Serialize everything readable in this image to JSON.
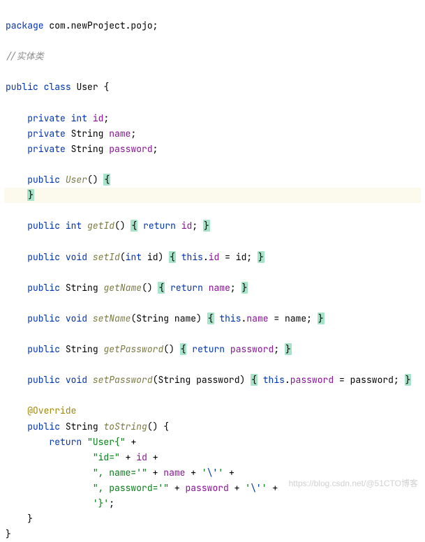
{
  "code": {
    "package_kw": "package",
    "package_name": "com.newProject.pojo",
    "comment": "//实体类",
    "class_decl": {
      "public": "public",
      "class": "class",
      "name": "User"
    },
    "fields": {
      "private": "private",
      "int": "int",
      "string": "String",
      "id": "id",
      "name": "name",
      "password": "password"
    },
    "ctor": {
      "public": "public",
      "name": "User"
    },
    "getId": {
      "public": "public",
      "ret": "int",
      "name": "getId",
      "return": "return",
      "field": "id"
    },
    "setId": {
      "public": "public",
      "ret": "void",
      "name": "setId",
      "pint": "int",
      "param": "id",
      "this": "this",
      "field": "id"
    },
    "getName": {
      "public": "public",
      "ret": "String",
      "name": "getName",
      "return": "return",
      "field": "name"
    },
    "setName": {
      "public": "public",
      "ret": "void",
      "name": "setName",
      "ptype": "String",
      "param": "name",
      "this": "this",
      "field": "name"
    },
    "getPassword": {
      "public": "public",
      "ret": "String",
      "name": "getPassword",
      "return": "return",
      "field": "password"
    },
    "setPassword": {
      "public": "public",
      "ret": "void",
      "name": "setPassword",
      "ptype": "String",
      "param": "password",
      "this": "this",
      "field": "password"
    },
    "override": "@Override",
    "toString": {
      "public": "public",
      "ret": "String",
      "name": "toString",
      "return": "return",
      "s1": "\"User{\"",
      "s2": "\"id=\"",
      "s3": "\", name='\"",
      "s4": "\", password='\"",
      "esc": "'\\''",
      "s5": "'}'",
      "plus": "+",
      "id": "id",
      "nameF": "name",
      "passwordF": "password"
    }
  },
  "watermark": "https://blog.csdn.net/@51CTO博客"
}
